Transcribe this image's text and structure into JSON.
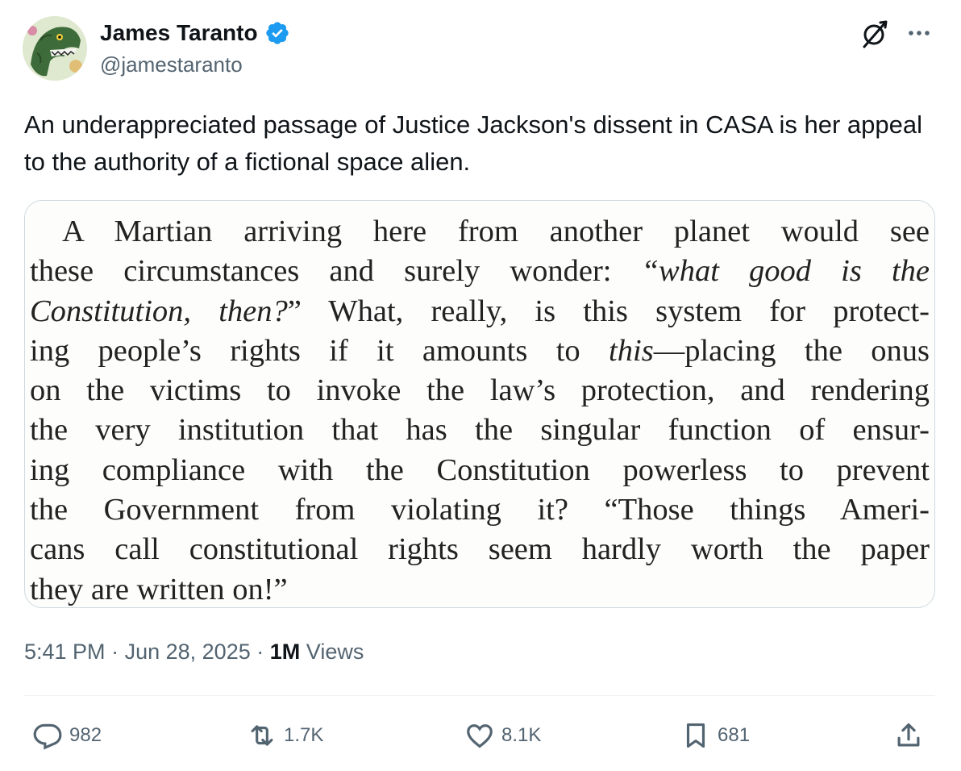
{
  "author": {
    "name": "James Taranto",
    "handle": "@jamestaranto",
    "verified": true,
    "verified_color": "#1d9bf0"
  },
  "tweet": {
    "text": "An underappreciated passage of Justice Jackson's dissent in CASA is her appeal to the authority of a fictional space alien."
  },
  "media": {
    "passage_lines": [
      "A Martian arriving here from another planet would see",
      "these circumstances and surely wonder: “what good is the",
      "Constitution, then?” What, really, is this system for protect-",
      "ing people’s rights if it amounts to this—placing the onus",
      "on the victims to invoke the law’s protection, and rendering",
      "the very institution that has the singular function of ensur-",
      "ing compliance with the Constitution powerless to prevent",
      "the Government from violating it? “Those things Ameri-",
      "cans call constitutional rights seem hardly worth the paper",
      "they are written on!”"
    ]
  },
  "meta": {
    "time": "5:41 PM",
    "separator": "·",
    "date": "Jun 28, 2025",
    "views_count": "1M",
    "views_label": "Views"
  },
  "actions": {
    "replies": "982",
    "reposts": "1.7K",
    "likes": "8.1K",
    "bookmarks": "681"
  },
  "icons": {
    "more": "more-icon",
    "grok": "grok-icon",
    "reply": "reply-icon",
    "repost": "repost-icon",
    "like": "heart-icon",
    "bookmark": "bookmark-icon",
    "share": "share-icon"
  },
  "colors": {
    "text": "#0f1419",
    "secondary": "#536471",
    "border": "#cfd9de"
  }
}
